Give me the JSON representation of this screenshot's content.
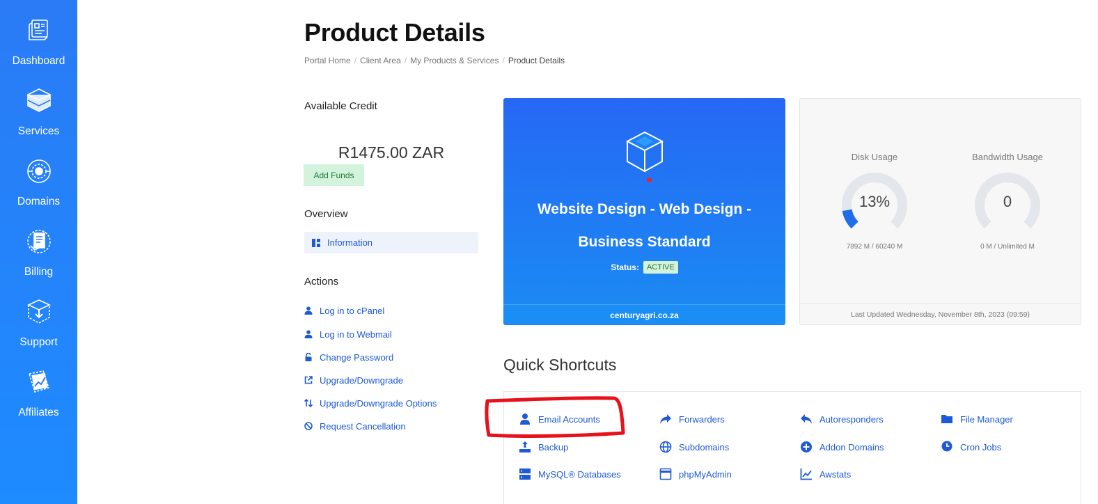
{
  "sidebar": {
    "items": [
      {
        "label": "Dashboard",
        "icon": "dashboard-icon"
      },
      {
        "label": "Services",
        "icon": "services-icon"
      },
      {
        "label": "Domains",
        "icon": "domains-icon"
      },
      {
        "label": "Billing",
        "icon": "billing-icon"
      },
      {
        "label": "Support",
        "icon": "support-icon"
      },
      {
        "label": "Affiliates",
        "icon": "affiliates-icon"
      }
    ]
  },
  "page": {
    "title": "Product Details",
    "breadcrumb": [
      "Portal Home",
      "Client Area",
      "My Products & Services",
      "Product Details"
    ]
  },
  "credit": {
    "heading": "Available Credit",
    "amount": "R1475.00 ZAR",
    "add_funds_label": "Add Funds"
  },
  "overview": {
    "heading": "Overview",
    "information_label": "Information"
  },
  "actions": {
    "heading": "Actions",
    "items": [
      {
        "label": "Log in to cPanel",
        "icon": "user-icon"
      },
      {
        "label": "Log in to Webmail",
        "icon": "user-icon"
      },
      {
        "label": "Change Password",
        "icon": "unlock-icon"
      },
      {
        "label": "Upgrade/Downgrade",
        "icon": "external-link-icon"
      },
      {
        "label": "Upgrade/Downgrade Options",
        "icon": "sort-arrows-icon"
      },
      {
        "label": "Request Cancellation",
        "icon": "ban-icon"
      }
    ]
  },
  "product": {
    "name_line1": "Website Design - Web Design -",
    "name_line2": "Business Standard",
    "status_label": "Status:",
    "status_value": "ACTIVE",
    "domain": "centuryagri.co.za",
    "icon": "cube-icon"
  },
  "usage": {
    "disk": {
      "title": "Disk Usage",
      "value": "13%",
      "percent": 13,
      "detail": "7892 M / 60240 M"
    },
    "bandwidth": {
      "title": "Bandwidth Usage",
      "value": "0",
      "percent": 0,
      "detail": "0 M / Unlimited M"
    },
    "last_updated": "Last Updated Wednesday, November 8th, 2023 (09:59)"
  },
  "shortcuts": {
    "title": "Quick Shortcuts",
    "items": [
      {
        "label": "Email Accounts",
        "icon": "user-icon"
      },
      {
        "label": "Forwarders",
        "icon": "share-arrow-icon"
      },
      {
        "label": "Autoresponders",
        "icon": "reply-icon"
      },
      {
        "label": "File Manager",
        "icon": "folder-icon"
      },
      {
        "label": "Backup",
        "icon": "upload-tray-icon"
      },
      {
        "label": "Subdomains",
        "icon": "globe-icon"
      },
      {
        "label": "Addon Domains",
        "icon": "plus-circle-icon"
      },
      {
        "label": "Cron Jobs",
        "icon": "clock-icon"
      },
      {
        "label": "MySQL® Databases",
        "icon": "server-icon"
      },
      {
        "label": "phpMyAdmin",
        "icon": "window-icon"
      },
      {
        "label": "Awstats",
        "icon": "line-chart-icon"
      }
    ]
  },
  "colors": {
    "sidebar": "#2a7bf5",
    "link": "#1d5ad6",
    "active_badge_bg": "#d4f3dc",
    "annotation": "#e8101a"
  }
}
